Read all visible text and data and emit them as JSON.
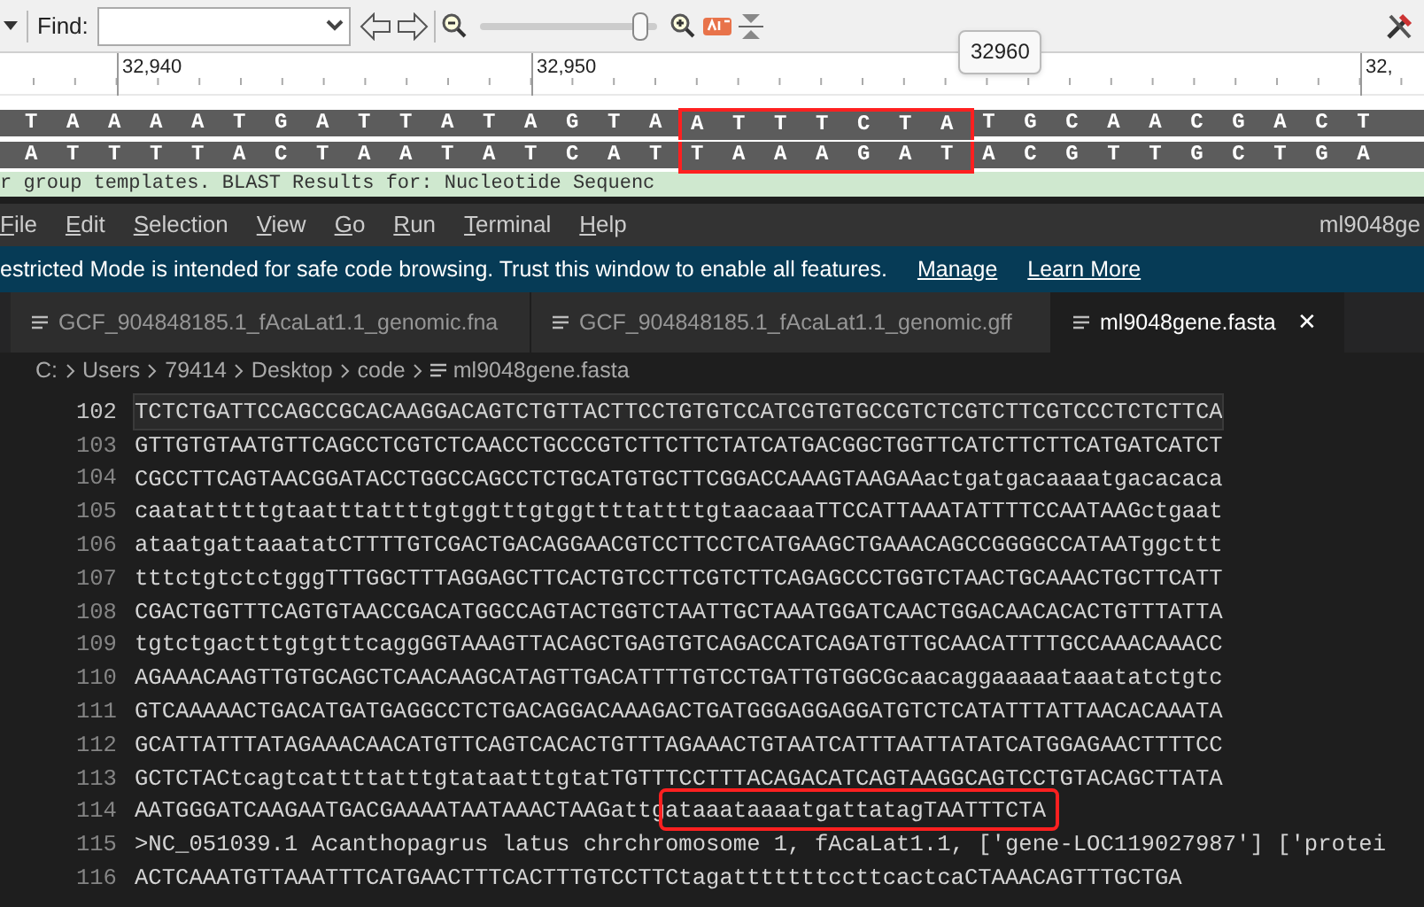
{
  "viewer": {
    "find_label": "Find:",
    "zoom_slider": {
      "level": 0.95
    },
    "ruler_labels": [
      "32,940",
      "32,950",
      "32,"
    ],
    "tooltip": "32960",
    "strands": [
      {
        "segments": [
          {
            "text": "T A A A A T G A T T A T A G T A",
            "boxed": false
          },
          {
            "text": "A T T T C T A",
            "boxed": true
          },
          {
            "text": "T G C A A C G A C T",
            "boxed": false
          }
        ]
      },
      {
        "segments": [
          {
            "text": "A T T T T A C T A A T A T C A T",
            "boxed": false
          },
          {
            "text": "T A A A G A T",
            "boxed": true
          },
          {
            "text": "A C G T T G C T G A",
            "boxed": false
          }
        ]
      }
    ],
    "annotation_strip": "r group templates. BLAST Results for: Nucleotide Sequenc"
  },
  "editor": {
    "menu": [
      "File",
      "Edit",
      "Selection",
      "View",
      "Go",
      "Run",
      "Terminal",
      "Help"
    ],
    "title": "ml9048ge",
    "banner": {
      "text": "estricted Mode is intended for safe code browsing. Trust this window to enable all features.",
      "links": [
        "Manage",
        "Learn More"
      ]
    },
    "tabs": [
      {
        "label": "GCF_904848185.1_fAcaLat1.1_genomic.fna",
        "selected": false
      },
      {
        "label": "GCF_904848185.1_fAcaLat1.1_genomic.gff",
        "selected": false
      },
      {
        "label": "ml9048gene.fasta",
        "selected": true,
        "close": "✕"
      }
    ],
    "breadcrumb": [
      "C:",
      "Users",
      "79414",
      "Desktop",
      "code",
      "ml9048gene.fasta"
    ],
    "lines": [
      {
        "number": "102",
        "current": true,
        "segments": [
          {
            "text": "TCTCTGATTCCAGCCGCACAAGGACAGTCTGTTACTTCCTGTGTCCATCGTGTGCCGTCTCGTCTTCGTCCCTCTCTTCA",
            "boxed": false
          }
        ]
      },
      {
        "number": "103",
        "current": false,
        "segments": [
          {
            "text": "GTTGTGTAATGTTCAGCCTCGTCTCAACCTGCCCGTCTTCTTCTATCATGACGGCTGGTTCATCTTCTTCATGATCATCT",
            "boxed": false
          }
        ]
      },
      {
        "number": "104",
        "current": false,
        "segments": [
          {
            "text": "CGCCTTCAGTAACGGATACCTGGCCAGCCTCTGCATGTGCTTCGGACCAAAGTAAGAAactgatgacaaaatgacacaca",
            "boxed": false
          }
        ]
      },
      {
        "number": "105",
        "current": false,
        "segments": [
          {
            "text": "caatatttttgtaatttattttgtggtttgtggttttattttgtaacaaaTTCCATTAAATATTTTCCAATAAGctgaat",
            "boxed": false
          }
        ]
      },
      {
        "number": "106",
        "current": false,
        "segments": [
          {
            "text": "ataatgattaaatatCTTTTGTCGACTGACAGGAACGTCCTTCCTCATGAAGCTGAAACAGCCGGGGCCATAATggcttt",
            "boxed": false
          }
        ]
      },
      {
        "number": "107",
        "current": false,
        "segments": [
          {
            "text": "tttctgtctctgggTTTGGCTTTAGGAGCTTCACTGTCCTTCGTCTTCAGAGCCCTGGTCTAACTGCAAACTGCTTCATT",
            "boxed": false
          }
        ]
      },
      {
        "number": "108",
        "current": false,
        "segments": [
          {
            "text": "CGACTGGTTTCAGTGTAACCGACATGGCCAGTACTGGTCTAATTGCTAAATGGATCAACTGGACAACACACTGTTTATTA",
            "boxed": false
          }
        ]
      },
      {
        "number": "109",
        "current": false,
        "segments": [
          {
            "text": "tgtctgactttgtgtttcaggGGTAAAGTTACAGCTGAGTGTCAGACCATCAGATGTTGCAACATTTTGCCAAACAAACC",
            "boxed": false
          }
        ]
      },
      {
        "number": "110",
        "current": false,
        "segments": [
          {
            "text": "AGAAACAAGTTGTGCAGCTCAACAAGCATAGTTGACATTTTGTCCTGATTGTGGCGcaacaggaaaaataaatatctgtc",
            "boxed": false
          }
        ]
      },
      {
        "number": "111",
        "current": false,
        "segments": [
          {
            "text": "GTCAAAAACTGACATGATGAGGCCTCTGACAGGACAAAGACTGATGGGAGGAGGATGTCTCATATTTATTAACACAAATA",
            "boxed": false
          }
        ]
      },
      {
        "number": "112",
        "current": false,
        "segments": [
          {
            "text": "GCATTATTTATAGAAACAACATGTTCAGTCACACTGTTTAGAAACTGTAATCATTTAATTATATCATGGAGAACTTTTCC",
            "boxed": false
          }
        ]
      },
      {
        "number": "113",
        "current": false,
        "segments": [
          {
            "text": "GCTCTACtcagtcattttatttgtataatttgtatTGTTTCCTTTACAGACATCAGTAAGGCAGTCCTGTACAGCTTATA",
            "boxed": false
          }
        ]
      },
      {
        "number": "114",
        "current": false,
        "segments": [
          {
            "text": "AATGGGATCAAGAATGACGAAAATAATAAACTAAGattg",
            "boxed": false
          },
          {
            "text": "ataaataaaatgattatagTAATTTCTA",
            "boxed": true
          }
        ]
      },
      {
        "number": "115",
        "current": false,
        "segments": [
          {
            "text": ">NC_051039.1 Acanthopagrus latus chrchromosome 1, fAcaLat1.1, ['gene-LOC119027987'] ['protei",
            "boxed": false
          }
        ]
      },
      {
        "number": "116",
        "current": false,
        "segments": [
          {
            "text": "ACTCAAATGTTAAATTTCATGAACTTTCACTTTGTCCTTCtagatttttttccttcactcaCTAAACAGTTTGCTGA",
            "boxed": false
          }
        ]
      }
    ]
  }
}
